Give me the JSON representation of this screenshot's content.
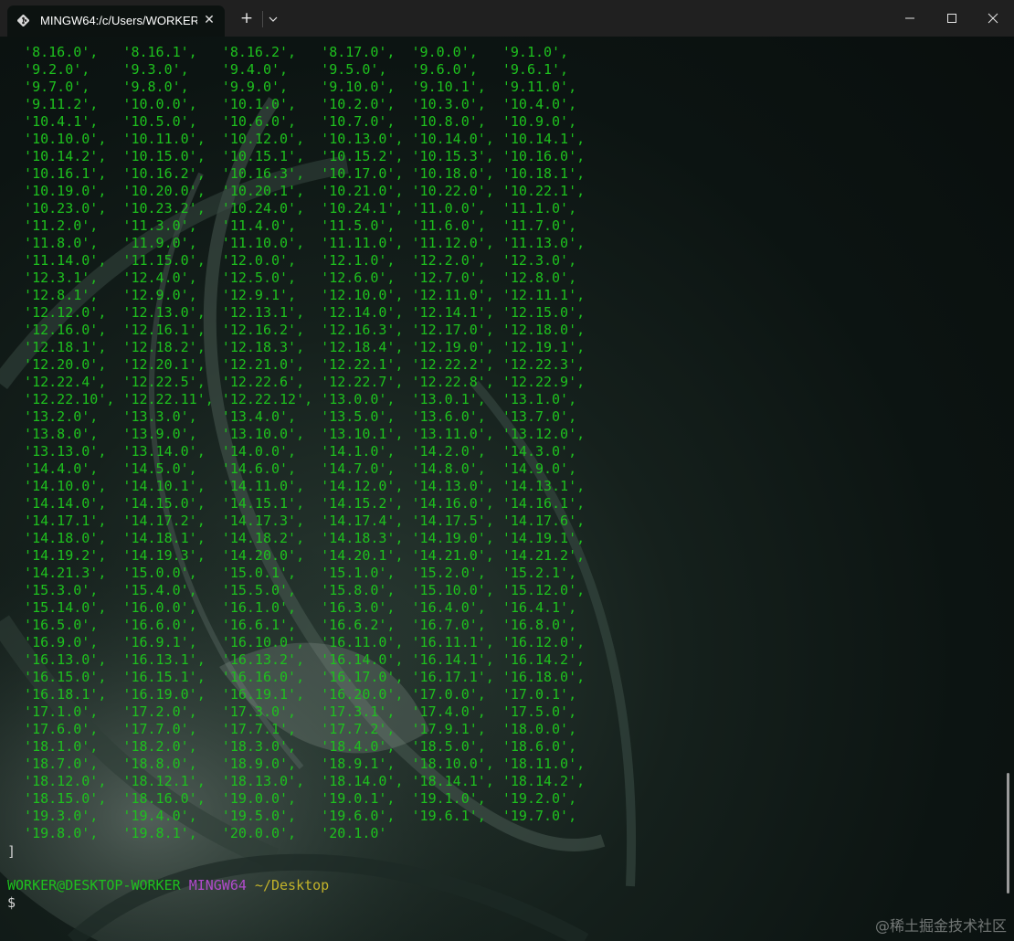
{
  "tab": {
    "title": "MINGW64:/c/Users/WORKER/",
    "icon": "git-bash-icon",
    "close_glyph": "✕"
  },
  "titlebar": {
    "new_tab_glyph": "+",
    "dropdown_glyph": "⌄"
  },
  "terminal": {
    "output_lines": [
      "  '8.16.0',   '8.16.1',   '8.16.2',   '8.17.0',  '9.0.0',   '9.1.0',",
      "  '9.2.0',    '9.3.0',    '9.4.0',    '9.5.0',   '9.6.0',   '9.6.1',",
      "  '9.7.0',    '9.8.0',    '9.9.0',    '9.10.0',  '9.10.1',  '9.11.0',",
      "  '9.11.2',   '10.0.0',   '10.1.0',   '10.2.0',  '10.3.0',  '10.4.0',",
      "  '10.4.1',   '10.5.0',   '10.6.0',   '10.7.0',  '10.8.0',  '10.9.0',",
      "  '10.10.0',  '10.11.0',  '10.12.0',  '10.13.0', '10.14.0', '10.14.1',",
      "  '10.14.2',  '10.15.0',  '10.15.1',  '10.15.2', '10.15.3', '10.16.0',",
      "  '10.16.1',  '10.16.2',  '10.16.3',  '10.17.0', '10.18.0', '10.18.1',",
      "  '10.19.0',  '10.20.0',  '10.20.1',  '10.21.0', '10.22.0', '10.22.1',",
      "  '10.23.0',  '10.23.2',  '10.24.0',  '10.24.1', '11.0.0',  '11.1.0',",
      "  '11.2.0',   '11.3.0',   '11.4.0',   '11.5.0',  '11.6.0',  '11.7.0',",
      "  '11.8.0',   '11.9.0',   '11.10.0',  '11.11.0', '11.12.0', '11.13.0',",
      "  '11.14.0',  '11.15.0',  '12.0.0',   '12.1.0',  '12.2.0',  '12.3.0',",
      "  '12.3.1',   '12.4.0',   '12.5.0',   '12.6.0',  '12.7.0',  '12.8.0',",
      "  '12.8.1',   '12.9.0',   '12.9.1',   '12.10.0', '12.11.0', '12.11.1',",
      "  '12.12.0',  '12.13.0',  '12.13.1',  '12.14.0', '12.14.1', '12.15.0',",
      "  '12.16.0',  '12.16.1',  '12.16.2',  '12.16.3', '12.17.0', '12.18.0',",
      "  '12.18.1',  '12.18.2',  '12.18.3',  '12.18.4', '12.19.0', '12.19.1',",
      "  '12.20.0',  '12.20.1',  '12.21.0',  '12.22.1', '12.22.2', '12.22.3',",
      "  '12.22.4',  '12.22.5',  '12.22.6',  '12.22.7', '12.22.8', '12.22.9',",
      "  '12.22.10', '12.22.11', '12.22.12', '13.0.0',  '13.0.1',  '13.1.0',",
      "  '13.2.0',   '13.3.0',   '13.4.0',   '13.5.0',  '13.6.0',  '13.7.0',",
      "  '13.8.0',   '13.9.0',   '13.10.0',  '13.10.1', '13.11.0', '13.12.0',",
      "  '13.13.0',  '13.14.0',  '14.0.0',   '14.1.0',  '14.2.0',  '14.3.0',",
      "  '14.4.0',   '14.5.0',   '14.6.0',   '14.7.0',  '14.8.0',  '14.9.0',",
      "  '14.10.0',  '14.10.1',  '14.11.0',  '14.12.0', '14.13.0', '14.13.1',",
      "  '14.14.0',  '14.15.0',  '14.15.1',  '14.15.2', '14.16.0', '14.16.1',",
      "  '14.17.1',  '14.17.2',  '14.17.3',  '14.17.4', '14.17.5', '14.17.6',",
      "  '14.18.0',  '14.18.1',  '14.18.2',  '14.18.3', '14.19.0', '14.19.1',",
      "  '14.19.2',  '14.19.3',  '14.20.0',  '14.20.1', '14.21.0', '14.21.2',",
      "  '14.21.3',  '15.0.0',   '15.0.1',   '15.1.0',  '15.2.0',  '15.2.1',",
      "  '15.3.0',   '15.4.0',   '15.5.0',   '15.8.0',  '15.10.0', '15.12.0',",
      "  '15.14.0',  '16.0.0',   '16.1.0',   '16.3.0',  '16.4.0',  '16.4.1',",
      "  '16.5.0',   '16.6.0',   '16.6.1',   '16.6.2',  '16.7.0',  '16.8.0',",
      "  '16.9.0',   '16.9.1',   '16.10.0',  '16.11.0', '16.11.1', '16.12.0',",
      "  '16.13.0',  '16.13.1',  '16.13.2',  '16.14.0', '16.14.1', '16.14.2',",
      "  '16.15.0',  '16.15.1',  '16.16.0',  '16.17.0', '16.17.1', '16.18.0',",
      "  '16.18.1',  '16.19.0',  '16.19.1',  '16.20.0', '17.0.0',  '17.0.1',",
      "  '17.1.0',   '17.2.0',   '17.3.0',   '17.3.1',  '17.4.0',  '17.5.0',",
      "  '17.6.0',   '17.7.0',   '17.7.1',   '17.7.2',  '17.9.1',  '18.0.0',",
      "  '18.1.0',   '18.2.0',   '18.3.0',   '18.4.0',  '18.5.0',  '18.6.0',",
      "  '18.7.0',   '18.8.0',   '18.9.0',   '18.9.1',  '18.10.0', '18.11.0',",
      "  '18.12.0',  '18.12.1',  '18.13.0',  '18.14.0', '18.14.1', '18.14.2',",
      "  '18.15.0',  '18.16.0',  '19.0.0',   '19.0.1',  '19.1.0',  '19.2.0',",
      "  '19.3.0',   '19.4.0',   '19.5.0',   '19.6.0',  '19.6.1',  '19.7.0',",
      "  '19.8.0',   '19.8.1',   '20.0.0',   '20.1.0'"
    ],
    "closing_bracket": "]",
    "prompt": {
      "user_host": "WORKER@DESKTOP-WORKER",
      "env": "MINGW64",
      "path": "~/Desktop"
    },
    "command_prompt": "$"
  },
  "colors": {
    "output_green": "#1ec11e",
    "prompt_env_purple": "#b14bcc",
    "prompt_path_yellow": "#c2b22a"
  },
  "watermark": "@稀土掘金技术社区"
}
